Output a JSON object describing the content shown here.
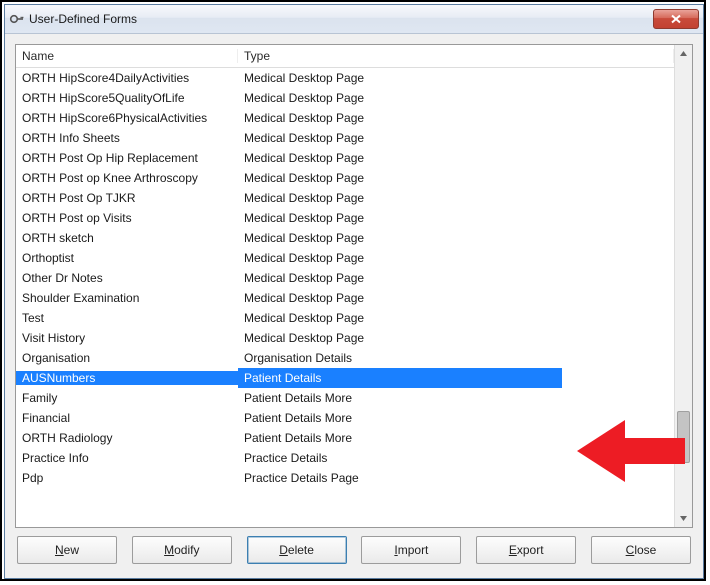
{
  "window": {
    "title": "User-Defined Forms"
  },
  "columns": {
    "name": "Name",
    "type": "Type"
  },
  "rows": [
    {
      "name": "ORTH HipScore4DailyActivities",
      "type": "Medical Desktop Page",
      "selected": false
    },
    {
      "name": "ORTH HipScore5QualityOfLife",
      "type": "Medical Desktop Page",
      "selected": false
    },
    {
      "name": "ORTH HipScore6PhysicalActivities",
      "type": "Medical Desktop Page",
      "selected": false
    },
    {
      "name": "ORTH Info Sheets",
      "type": "Medical Desktop Page",
      "selected": false
    },
    {
      "name": "ORTH Post Op Hip Replacement",
      "type": "Medical Desktop Page",
      "selected": false
    },
    {
      "name": "ORTH Post op Knee Arthroscopy",
      "type": "Medical Desktop Page",
      "selected": false
    },
    {
      "name": "ORTH Post Op TJKR",
      "type": "Medical Desktop Page",
      "selected": false
    },
    {
      "name": "ORTH Post op Visits",
      "type": "Medical Desktop Page",
      "selected": false
    },
    {
      "name": "ORTH sketch",
      "type": "Medical Desktop Page",
      "selected": false
    },
    {
      "name": "Orthoptist",
      "type": "Medical Desktop Page",
      "selected": false
    },
    {
      "name": "Other Dr Notes",
      "type": "Medical Desktop Page",
      "selected": false
    },
    {
      "name": "Shoulder Examination",
      "type": "Medical Desktop Page",
      "selected": false
    },
    {
      "name": "Test",
      "type": "Medical Desktop Page",
      "selected": false
    },
    {
      "name": "Visit History",
      "type": "Medical Desktop Page",
      "selected": false
    },
    {
      "name": "Organisation",
      "type": "Organisation Details",
      "selected": false
    },
    {
      "name": "AUSNumbers",
      "type": "Patient Details",
      "selected": true
    },
    {
      "name": "Family",
      "type": "Patient Details More",
      "selected": false
    },
    {
      "name": "Financial",
      "type": "Patient Details More",
      "selected": false
    },
    {
      "name": "ORTH Radiology",
      "type": "Patient Details More",
      "selected": false
    },
    {
      "name": "Practice Info",
      "type": "Practice Details",
      "selected": false
    },
    {
      "name": "Pdp",
      "type": "Practice Details Page",
      "selected": false
    }
  ],
  "buttons": {
    "new": {
      "label": "New",
      "mnemonic_index": 0
    },
    "modify": {
      "label": "Modify",
      "mnemonic_index": 0
    },
    "delete": {
      "label": "Delete",
      "mnemonic_index": 0,
      "focused": true
    },
    "import": {
      "label": "Import",
      "mnemonic_index": 0
    },
    "export": {
      "label": "Export",
      "mnemonic_index": 0
    },
    "close": {
      "label": "Close",
      "mnemonic_index": 0
    }
  },
  "annotation": {
    "arrow_target_row_index": 15
  }
}
